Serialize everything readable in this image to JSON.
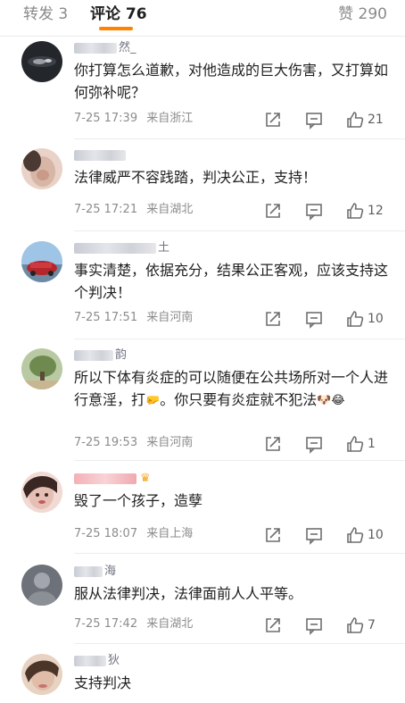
{
  "tabs": {
    "repost": "转发 3",
    "comments": "评论 76",
    "likes": "赞 290"
  },
  "comments": [
    {
      "name_suffix": "然_",
      "text": "你打算怎么道歉，对他造成的巨大伤害，又打算如何弥补呢？",
      "time": "7-25 17:39",
      "location": "来自浙江",
      "likes": "21"
    },
    {
      "name_suffix": "",
      "text": "法律威严不容践踏，判决公正，支持！",
      "time": "7-25 17:21",
      "location": "来自湖北",
      "likes": "12"
    },
    {
      "name_suffix": "土",
      "text": "事实清楚，依据充分，结果公正客观，应该支持这个判决！",
      "time": "7-25 17:51",
      "location": "来自河南",
      "likes": "10"
    },
    {
      "name_suffix": "韵",
      "text": "所以下体有炎症的可以随便在公共场所对一个人进行意淫，打",
      "text_mid": "。你只要有炎症就不犯法",
      "time": "7-25 19:53",
      "location": "来自河南",
      "likes": "1"
    },
    {
      "name_suffix": "",
      "text": "毁了一个孩子，造孽",
      "time": "7-25 18:07",
      "location": "来自上海",
      "likes": "10"
    },
    {
      "name_suffix": "海",
      "text": "服从法律判决，法律面前人人平等。",
      "time": "7-25 17:42",
      "location": "来自湖北",
      "likes": "7"
    },
    {
      "name_suffix": "狄",
      "text": "支持判决"
    }
  ],
  "icons": {
    "share": "share-icon",
    "comment": "comment-icon",
    "like": "thumbs-up-icon"
  },
  "colors": {
    "accent": "#ff8200",
    "meta_text": "#8c8c8c"
  }
}
